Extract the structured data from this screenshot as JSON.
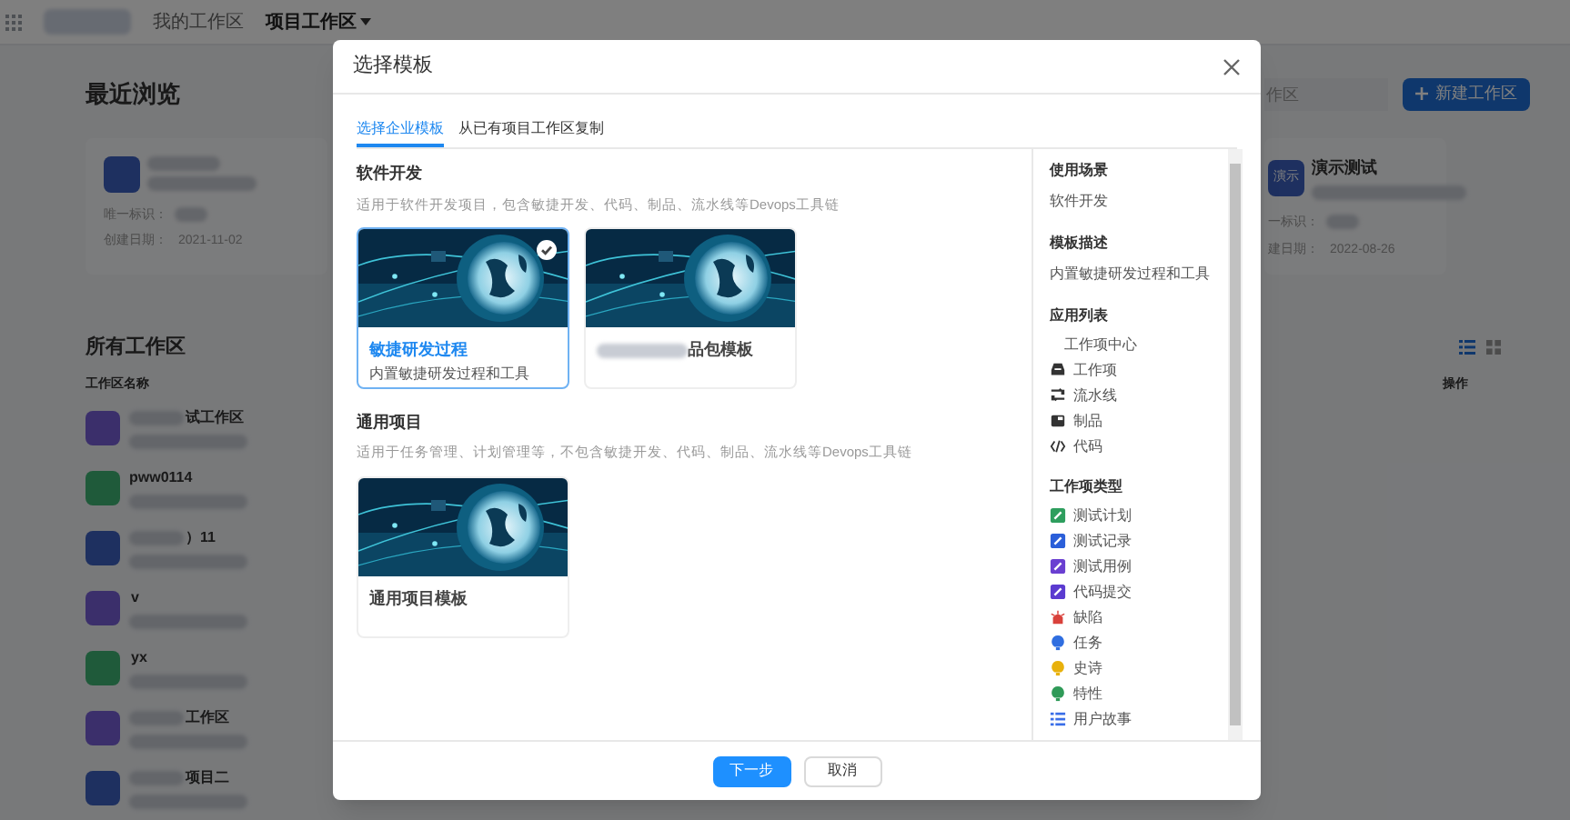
{
  "nav": {
    "items": [
      {
        "label": "我的工作区",
        "selected": false
      },
      {
        "label": "项目工作区",
        "selected": true
      }
    ]
  },
  "recent": {
    "title": "最近浏览",
    "search_placeholder": "作区",
    "new_button": "新建工作区",
    "cards": [
      {
        "color": "#1e3060",
        "id_label": "唯一标识：",
        "date_label": "创建日期：",
        "date": "2021-11-02"
      },
      {
        "color": "#1e3060",
        "avatar_text": "演示",
        "name": "演示测试",
        "id_label": "一标识：",
        "date_label": "建日期：",
        "date": "2022-08-26"
      }
    ]
  },
  "all": {
    "title": "所有工作区",
    "columns": [
      "工作区名称",
      "操作"
    ],
    "rows": [
      {
        "color": "#3b2f6b",
        "name": "试工作区"
      },
      {
        "color": "#1f5a3a",
        "name": "pww0114"
      },
      {
        "color": "#1e3060",
        "name": "）11"
      },
      {
        "color": "#3b2f6b",
        "name": "v"
      },
      {
        "color": "#1f5a3a",
        "name": "yx"
      },
      {
        "color": "#3b2f6b",
        "name": "工作区"
      },
      {
        "color": "#1e3060",
        "name": "项目二"
      }
    ]
  },
  "dialog": {
    "title": "选择模板",
    "tabs": [
      {
        "label": "选择企业模板",
        "selected": true
      },
      {
        "label": "从已有项目工作区复制",
        "selected": false
      }
    ],
    "sections": [
      {
        "title": "软件开发",
        "description": "适用于软件开发项目，包含敏捷开发、代码、制品、流水线等Devops工具链",
        "templates": [
          {
            "name": "敏捷研发过程",
            "description": "内置敏捷研发过程和工具",
            "selected": true
          },
          {
            "name": "品包模板",
            "selected": false
          }
        ]
      },
      {
        "title": "通用项目",
        "description": "适用于任务管理、计划管理等，不包含敏捷开发、代码、制品、流水线等Devops工具链",
        "templates": [
          {
            "name": "通用项目模板",
            "selected": false
          }
        ]
      }
    ],
    "details": [
      {
        "title": "使用场景",
        "text": "软件开发"
      },
      {
        "title": "模板描述",
        "text": "内置敏捷研发过程和工具"
      },
      {
        "title": "应用列表",
        "items": [
          {
            "label": "工作项中心",
            "kind": "plain"
          },
          {
            "label": "工作项",
            "kind": "inbox"
          },
          {
            "label": "流水线",
            "kind": "pipeline"
          },
          {
            "label": "制品",
            "kind": "artifact"
          },
          {
            "label": "代码",
            "kind": "code"
          }
        ]
      },
      {
        "title": "工作项类型",
        "items": [
          {
            "label": "测试计划",
            "kind": "square",
            "color": "#2e9e5e"
          },
          {
            "label": "测试记录",
            "kind": "square",
            "color": "#2b5fd9"
          },
          {
            "label": "测试用例",
            "kind": "square",
            "color": "#6a3fd1"
          },
          {
            "label": "代码提交",
            "kind": "square",
            "color": "#5b3bd0"
          },
          {
            "label": "缺陷",
            "kind": "bug",
            "color": "#d9413b"
          },
          {
            "label": "任务",
            "kind": "bulb",
            "color": "#2f6ee0"
          },
          {
            "label": "史诗",
            "kind": "bulb",
            "color": "#e8b10c"
          },
          {
            "label": "特性",
            "kind": "bulb",
            "color": "#2f9a58"
          },
          {
            "label": "用户故事",
            "kind": "list",
            "color": "#3a6ee8"
          }
        ]
      }
    ],
    "buttons": [
      {
        "label": "下一步",
        "kind": "primary"
      },
      {
        "label": "取消",
        "kind": "default"
      }
    ]
  }
}
